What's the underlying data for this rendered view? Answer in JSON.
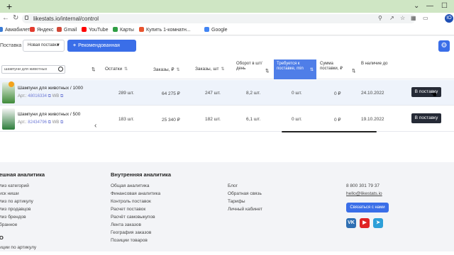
{
  "browser": {
    "new_tab_symbol": "+",
    "url": "likestats.io/internal/control",
    "window_controls": [
      "⌄",
      "—",
      "☐"
    ]
  },
  "bookmarks": [
    {
      "label": "Авиабилеты",
      "color": "#3a7bd5"
    },
    {
      "label": "Яндекс",
      "color": "#e33b2e"
    },
    {
      "label": "Gmail",
      "color": "#d14836"
    },
    {
      "label": "YouTube",
      "color": "#ff0000"
    },
    {
      "label": "Карты",
      "color": "#2f9e44"
    },
    {
      "label": "Купить 1-комнатн...",
      "color": "#e8542e"
    },
    {
      "label": "Google",
      "color": "#4285f4"
    }
  ],
  "toolbar": {
    "label": "Поставка",
    "select_value": "Новая поставка",
    "recommended_button": "Рекомендованная поставка"
  },
  "table": {
    "search_placeholder": "шампуни для животных",
    "headers": {
      "stock": "Остатки",
      "orders_rub": "Заказы, ₽",
      "orders_qty": "Заказы, шт",
      "turnover": "Оборот в шт/день",
      "required": "Требуется к поставке, min",
      "supply_sum": "Сумма поставки, ₽",
      "in_stock_until": "В наличие до"
    },
    "rows": [
      {
        "name": "Шампуни для животных / 1000",
        "article_label": "Арт.:",
        "article": "48016334",
        "wb": "WB",
        "stock": "289 шт.",
        "orders_rub": "64 275 ₽",
        "orders_qty": "247 шт.",
        "turnover": "8,2 шт.",
        "required": "0 шт.",
        "supply_sum": "0 ₽",
        "in_stock_until": "24.10.2022",
        "action": "В поставку"
      },
      {
        "name": "Шампуни для животных / 500",
        "article_label": "Арт.:",
        "article": "82434796",
        "wb": "WB",
        "stock": "183 шт.",
        "orders_rub": "25 340 ₽",
        "orders_qty": "182 шт.",
        "turnover": "6,1 шт.",
        "required": "0 шт.",
        "supply_sum": "0 ₽",
        "in_stock_until": "19.10.2022",
        "action": "В поставку"
      }
    ]
  },
  "footer": {
    "col1": {
      "heading": "ешная аналитика",
      "items": [
        "лиз категорий",
        "иск ниши",
        "лиз по артикулу",
        "лиз продавцов",
        "лиз брендов",
        "бранное"
      ],
      "heading2": "O",
      "items2": [
        "иции по артикулу"
      ]
    },
    "col2": {
      "heading": "Внутренняя аналитика",
      "items": [
        "Общая аналитика",
        "Финансовая аналитика",
        "Контроль поставок",
        "Расчет поставок",
        "Расчёт самовыкупов",
        "Лента заказов",
        "География заказов",
        "Позиции товаров"
      ]
    },
    "col3": {
      "items": [
        "Блог",
        "Обратная связь",
        "Тарифы",
        "Личный кабинет"
      ]
    },
    "col4": {
      "phone": "8 800 301 79 37",
      "email": "hello@likestats.io",
      "contact_button": "Связаться с нами",
      "social": [
        {
          "name": "vk",
          "glyph": "VK",
          "color": "#2f6fb3"
        },
        {
          "name": "youtube",
          "glyph": "▶",
          "color": "#e02424"
        },
        {
          "name": "telegram",
          "glyph": "➤",
          "color": "#2d9fd8"
        }
      ]
    }
  },
  "colors": {
    "accent": "#3a6ee8",
    "highlight_header": "#4f7ee8",
    "dark_button": "#252a36"
  }
}
